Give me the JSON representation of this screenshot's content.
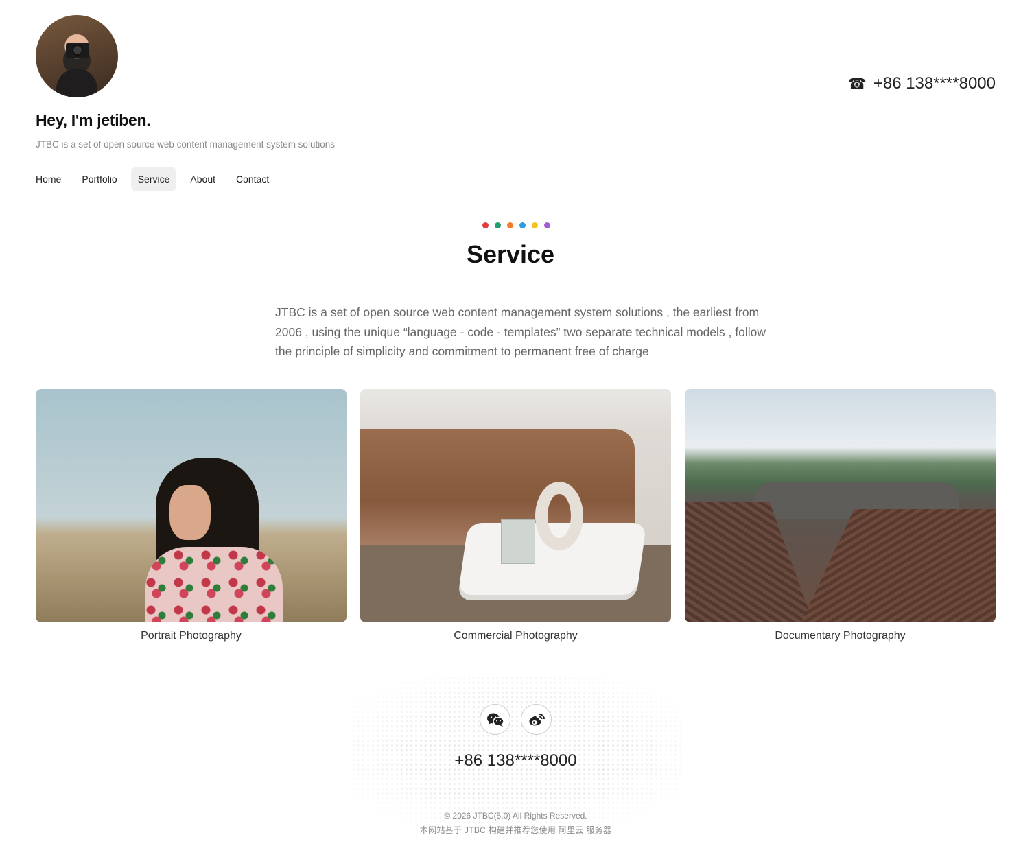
{
  "header": {
    "title": "Hey, I'm jetiben.",
    "subtitle": "JTBC is a set of open source web content management system solutions",
    "phone": "+86 138****8000",
    "phone_icon": "phone-icon"
  },
  "nav": {
    "items": [
      {
        "label": "Home"
      },
      {
        "label": "Portfolio"
      },
      {
        "label": "Service"
      },
      {
        "label": "About"
      },
      {
        "label": "Contact"
      }
    ],
    "active": "Service"
  },
  "section": {
    "dot_colors": [
      "#e03e3e",
      "#1f9e6f",
      "#f07b2a",
      "#2f9be0",
      "#f4c21b",
      "#a65bd6"
    ],
    "title": "Service",
    "intro": "JTBC is a set of open source web content management system solutions , the earliest from 2006 , using the unique “language - code - templates” two separate technical models , follow the principle of simplicity and commitment to permanent free of charge"
  },
  "cards": [
    {
      "caption": "Portrait Photography"
    },
    {
      "caption": "Commercial Photography"
    },
    {
      "caption": "Documentary Photography"
    }
  ],
  "footer": {
    "social": [
      {
        "icon": "wechat-icon"
      },
      {
        "icon": "weibo-icon"
      }
    ],
    "phone": "+86 138****8000",
    "copyright": "© 2026 JTBC(5.0) All Rights Reserved.",
    "powered": "本网站基于 JTBC 构建并推荐您使用 阿里云 服务器"
  }
}
